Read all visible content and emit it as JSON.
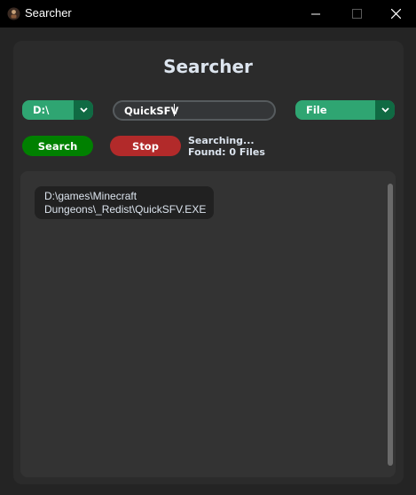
{
  "window": {
    "title": "Searcher",
    "icon": "searcher-app-icon",
    "controls": [
      "minimize-icon",
      "maximize-icon",
      "close-icon"
    ]
  },
  "main": {
    "heading": "Searcher"
  },
  "drive_select": {
    "value": "D:\\",
    "icon": "chevron-down-icon"
  },
  "search": {
    "value": "QuickSFV"
  },
  "type_select": {
    "value": "File",
    "icon": "chevron-down-icon"
  },
  "buttons": {
    "search_label": "Search",
    "stop_label": "Stop"
  },
  "status": {
    "line1": "Searching...",
    "line2": "Found: 0 Files"
  },
  "results": [
    {
      "line1": "D:\\games\\Minecraft",
      "line2": "Dungeons\\_Redist\\QuickSFV.EXE"
    }
  ],
  "colors": {
    "accent_green": "#2fa572",
    "accent_green_dark": "#106a43",
    "search_button": "#008000",
    "stop_button": "#b22a2a",
    "background": "#242424",
    "panel": "#2b2b2b"
  }
}
